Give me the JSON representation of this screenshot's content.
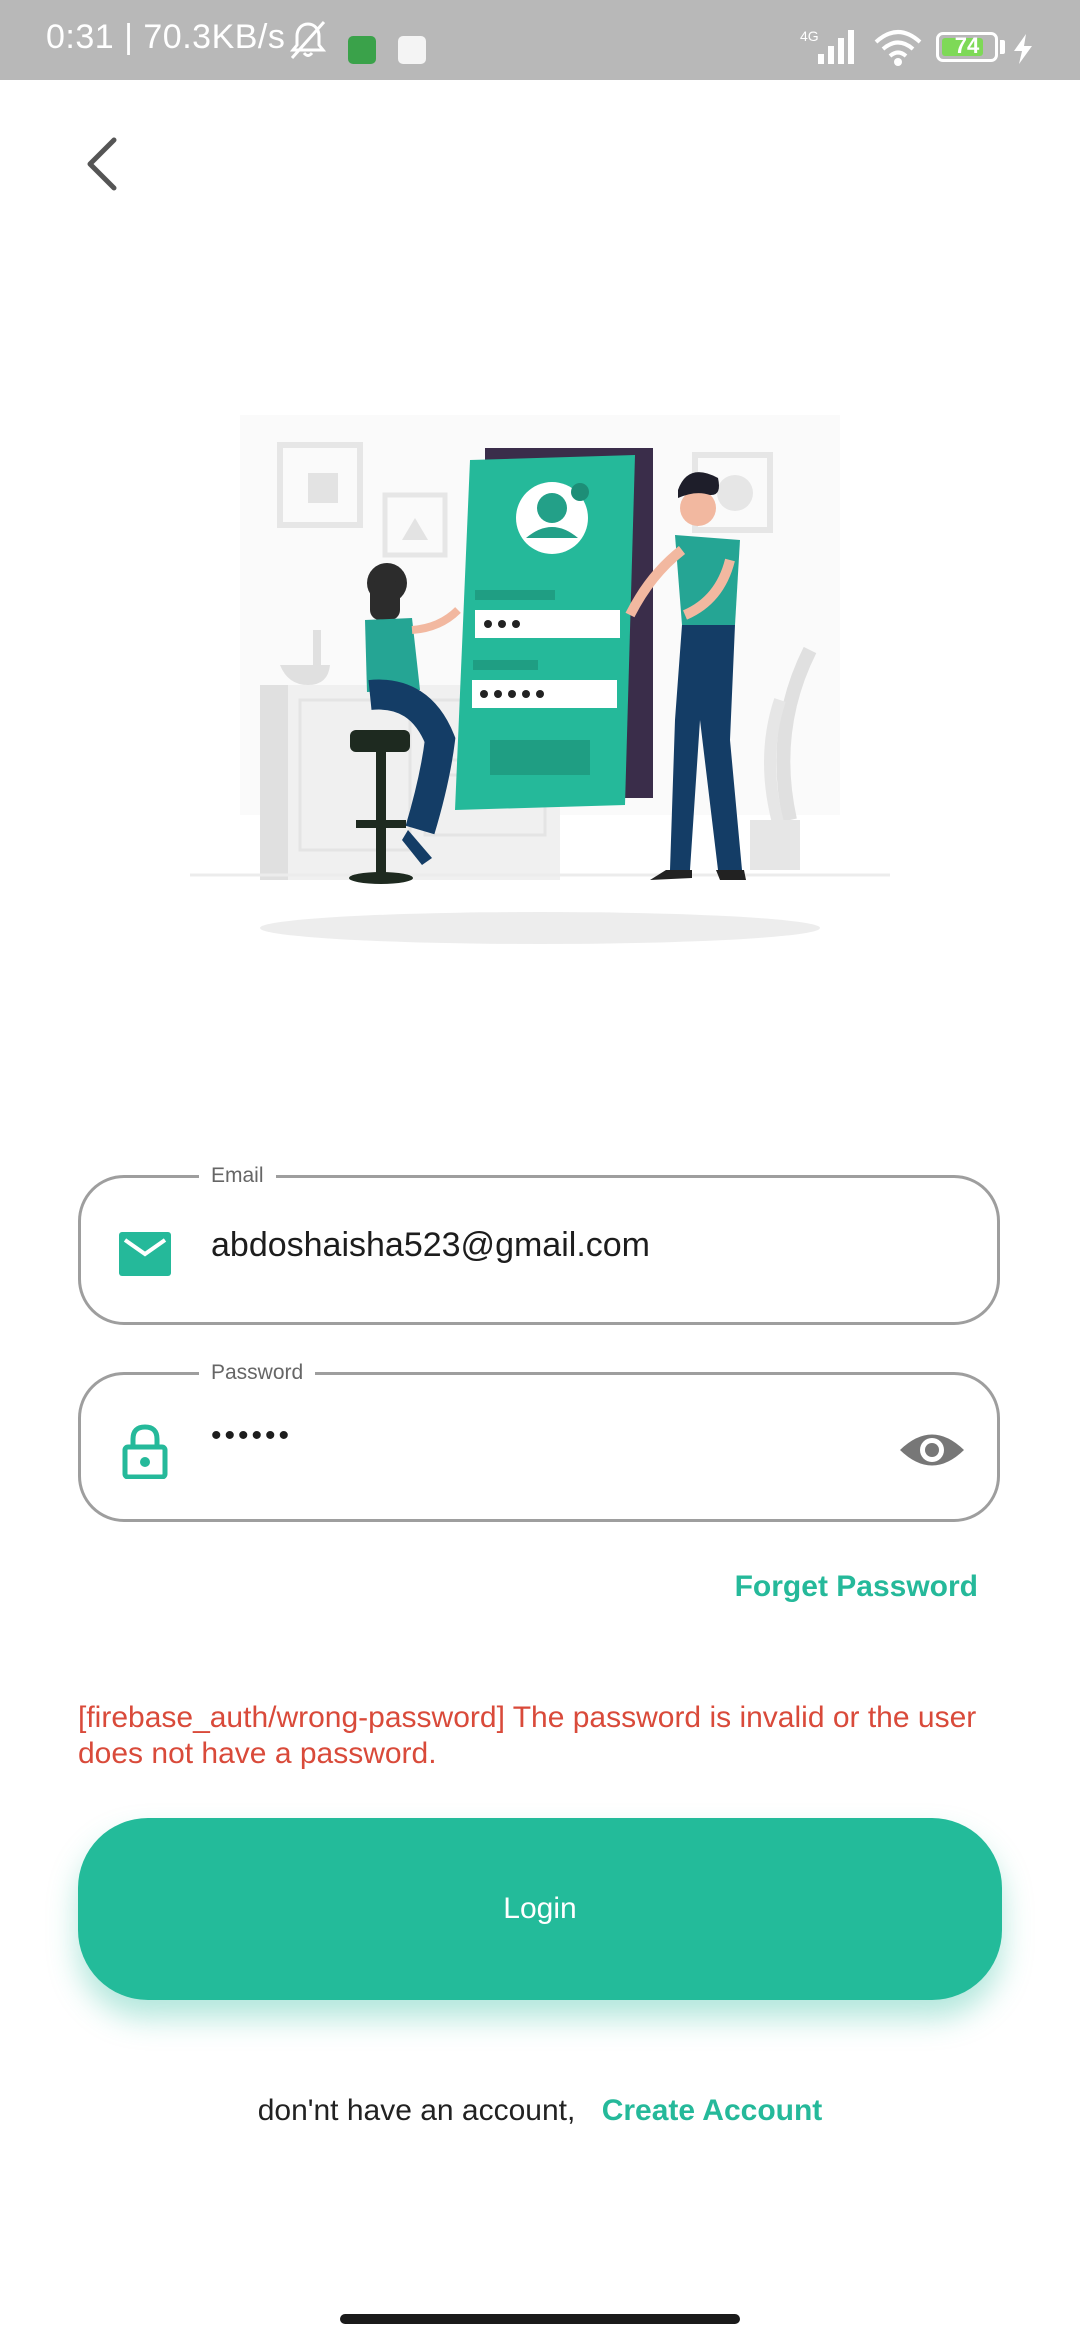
{
  "status_bar": {
    "time_speed": "0:31 | 70.3KB/s",
    "network": "4G",
    "battery": "74"
  },
  "form": {
    "email_label": "Email",
    "email_value": "abdoshaisha523@gmail.com",
    "password_label": "Password",
    "password_value": "••••••"
  },
  "links": {
    "forget_password": "Forget Password"
  },
  "error_message": "[firebase_auth/wrong-password] The password is invalid or the user does not have a password.",
  "login_button": "Login",
  "signup": {
    "prompt": "don'nt have an account,",
    "link": "Create Account"
  },
  "colors": {
    "accent": "#23bb9a",
    "error": "#d94a3a",
    "status_bar": "#b8b8b8"
  },
  "icons": {
    "back": "back-arrow-icon",
    "email": "mail-icon",
    "password": "lock-icon",
    "visibility": "eye-icon"
  }
}
